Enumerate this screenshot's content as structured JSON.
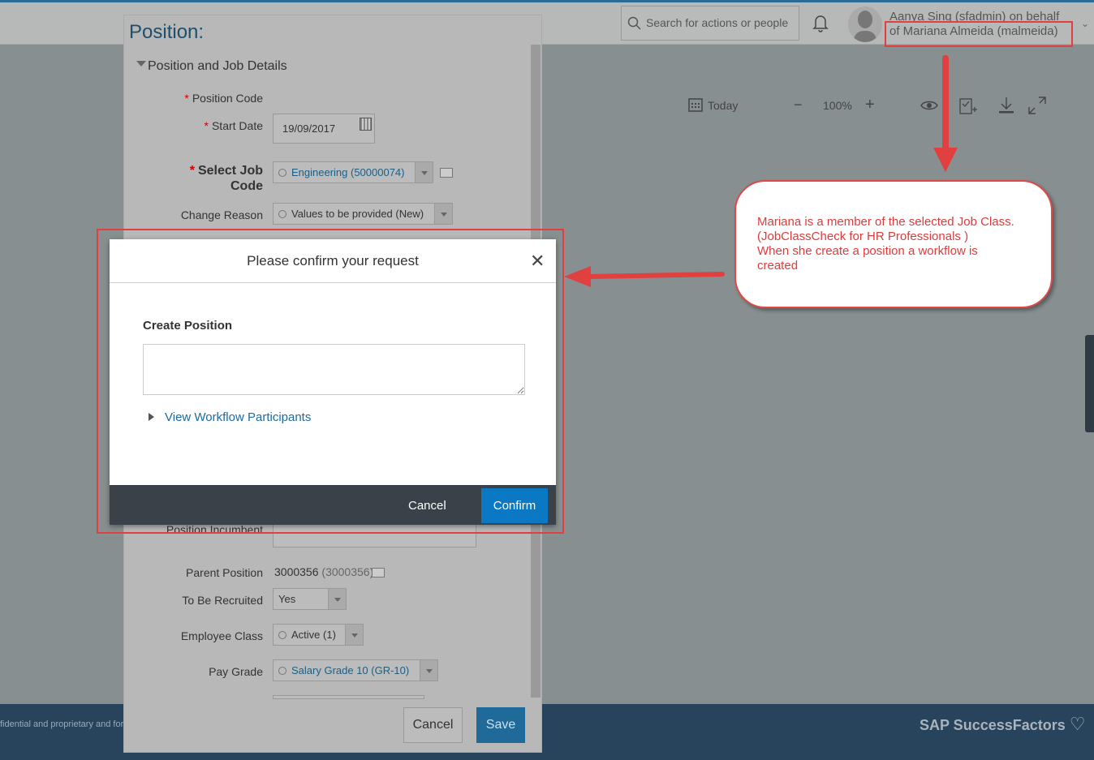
{
  "header": {
    "search_placeholder": "Search for actions or people",
    "user_line1": "Aanya Sing (sfadmin) on behalf",
    "user_line2": "of Mariana Almeida (malmeida)"
  },
  "toolbar": {
    "today": "Today",
    "zoom_minus": "−",
    "zoom": "100%",
    "zoom_plus": "+"
  },
  "panel": {
    "title": "Position:",
    "section": "Position and Job Details",
    "fields": {
      "position_code": "Position Code",
      "start_date": "Start Date",
      "start_date_value": "19/09/2017",
      "job_code_l1": "Select Job",
      "job_code_l2": "Code",
      "job_code_value": "Engineering (50000074)",
      "change_reason": "Change Reason",
      "change_reason_value": "Values to be provided (New)",
      "incumbent": "Position Incumbent",
      "parent_position": "Parent Position",
      "parent_position_value": "3000356",
      "parent_position_code": "(3000356)",
      "to_be_recruited": "To Be Recruited",
      "to_be_recruited_value": "Yes",
      "employee_class": "Employee Class",
      "employee_class_value": "Active (1)",
      "pay_grade": "Pay Grade",
      "pay_grade_value": "Salary Grade 10 (GR-10)"
    },
    "cancel": "Cancel",
    "save": "Save"
  },
  "dialog": {
    "title": "Please confirm your request",
    "subtitle": "Create Position",
    "comment_value": "",
    "view_participants": "View Workflow Participants",
    "cancel": "Cancel",
    "confirm": "Confirm"
  },
  "annotation": {
    "l1": "Mariana is a member of the selected Job Class.",
    "l2": "(JobClassCheck for HR Professionals )",
    "l3": "When she create a position a workflow is",
    "l4": "created",
    "color": "#e04040"
  },
  "footer": {
    "text": "fidential and proprietary and for",
    "logo": "SAP SuccessFactors"
  }
}
